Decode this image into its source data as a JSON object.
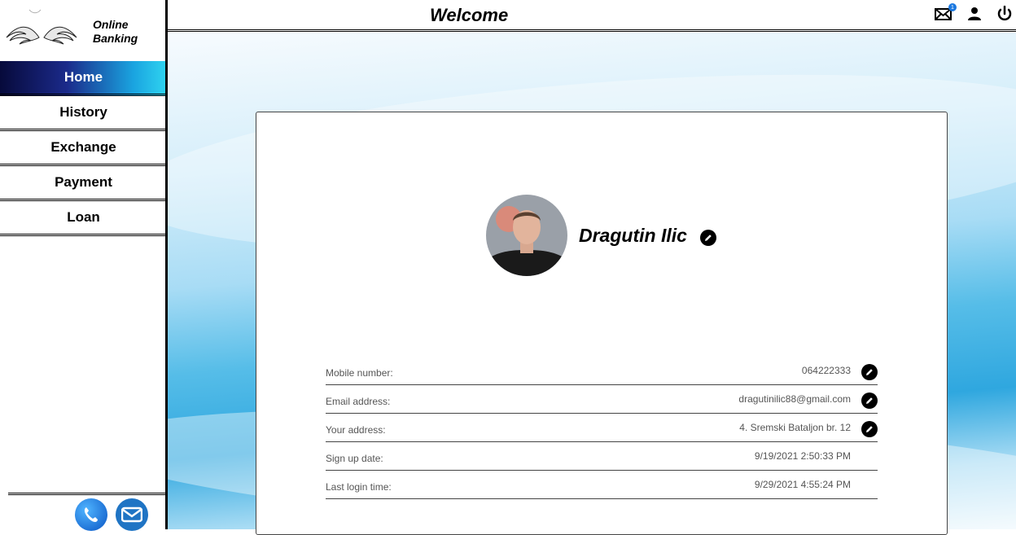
{
  "brand": {
    "line1": "Online",
    "line2": "Banking"
  },
  "header": {
    "title": "Welcome",
    "notification_count": "1"
  },
  "nav": {
    "items": [
      {
        "label": "Home"
      },
      {
        "label": "History"
      },
      {
        "label": "Exchange"
      },
      {
        "label": "Payment"
      },
      {
        "label": "Loan"
      }
    ]
  },
  "profile": {
    "name": "Dragutin Ilic",
    "fields": [
      {
        "label": "Mobile number:",
        "value": "064222333"
      },
      {
        "label": "Email address:",
        "value": "dragutinilic88@gmail.com"
      },
      {
        "label": "Your address:",
        "value": "4. Sremski Bataljon br. 12"
      },
      {
        "label": "Sign up date:",
        "value": "9/19/2021 2:50:33 PM"
      },
      {
        "label": "Last login time:",
        "value": "9/29/2021 4:55:24 PM"
      }
    ]
  },
  "icons": [
    "wings-logo-icon",
    "mail-icon",
    "user-icon",
    "power-icon",
    "edit-icon",
    "phone-icon",
    "envelope-icon"
  ],
  "colors": {
    "accent_dark": "#070a3b",
    "accent_light": "#2fd4f0",
    "mail_blue": "#1f74c4"
  }
}
